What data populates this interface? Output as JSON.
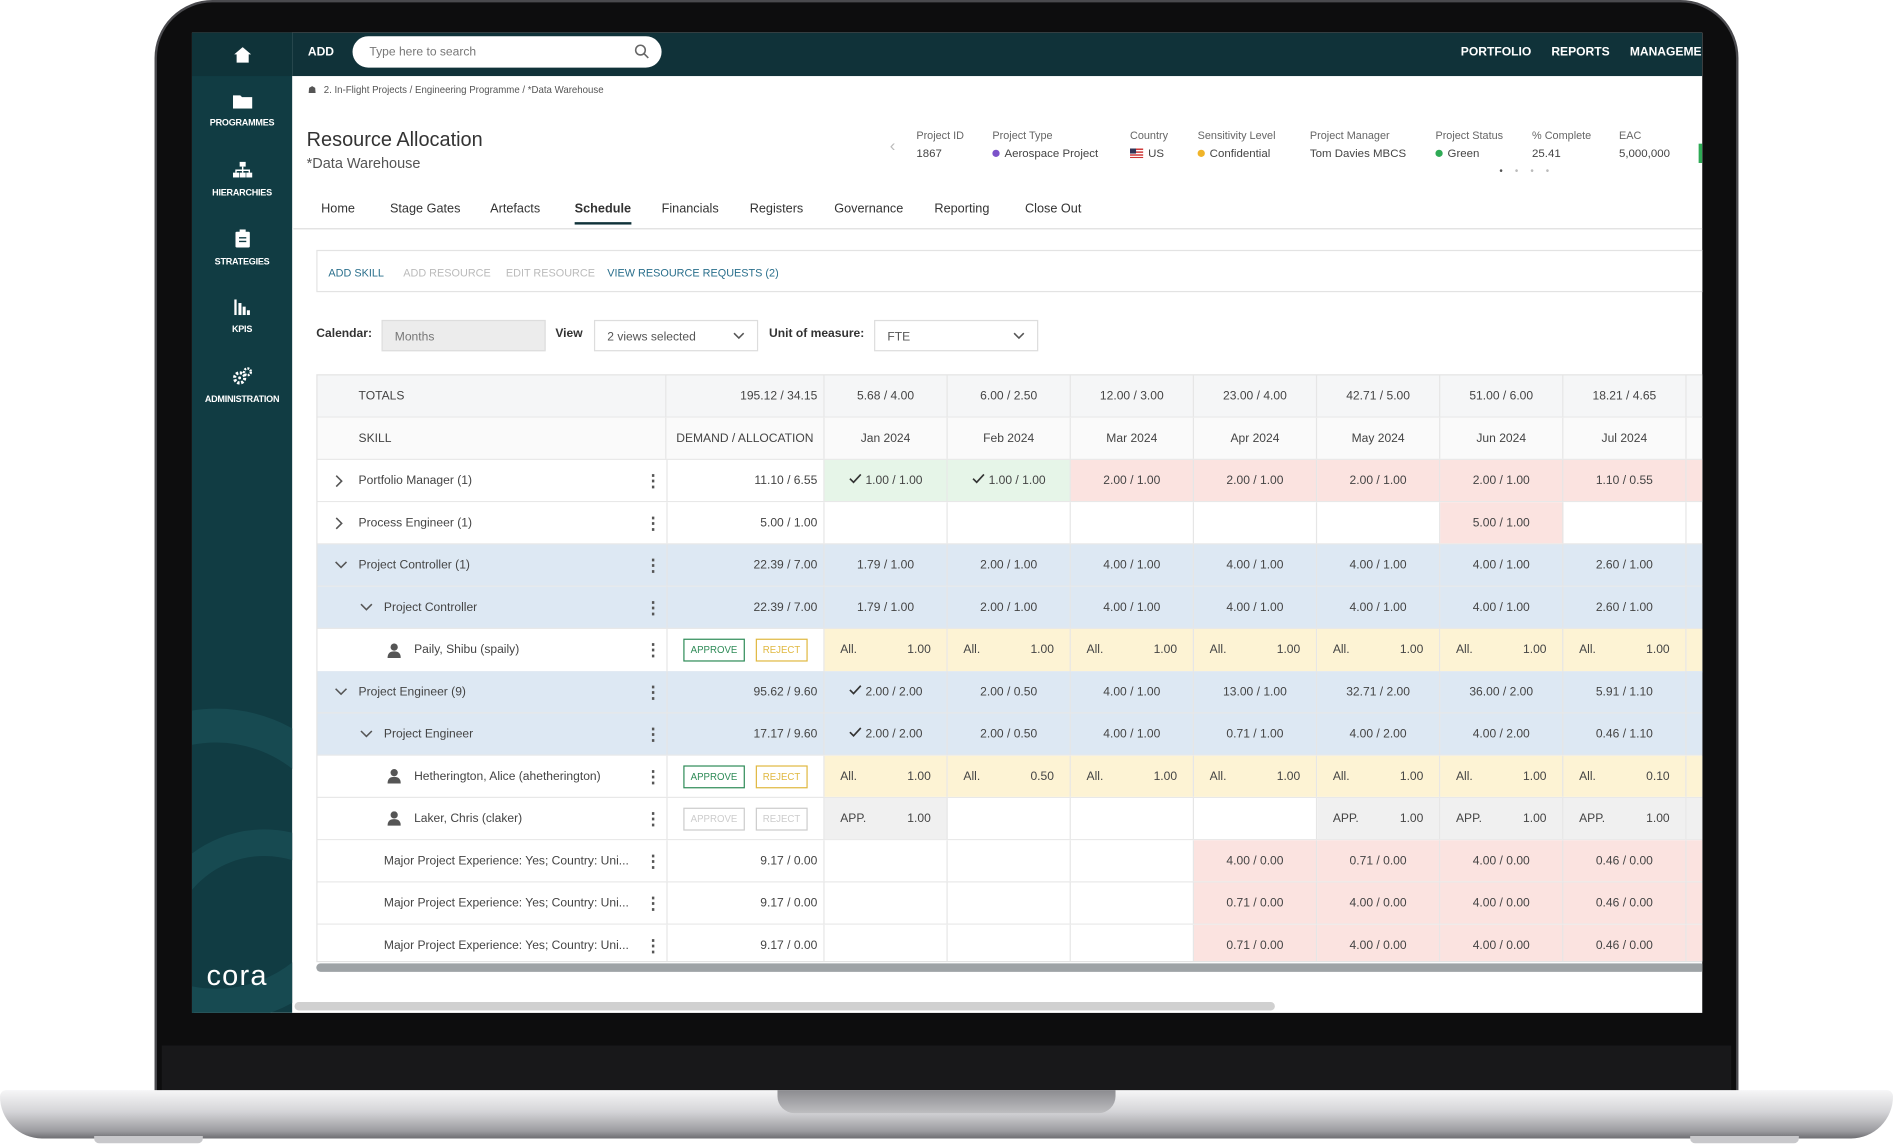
{
  "sidebar": {
    "items": [
      {
        "label": "PROGRAMMES",
        "icon": "folder-icon"
      },
      {
        "label": "HIERARCHIES",
        "icon": "hierarchy-icon"
      },
      {
        "label": "STRATEGIES",
        "icon": "clipboard-icon"
      },
      {
        "label": "KPIS",
        "icon": "bar-chart-icon"
      },
      {
        "label": "ADMINISTRATION",
        "icon": "gears-icon"
      }
    ],
    "logo": "cora"
  },
  "topbar": {
    "add_label": "ADD",
    "search_placeholder": "Type here to search",
    "menu": [
      "PORTFOLIO",
      "REPORTS",
      "MANAGEMEN"
    ]
  },
  "breadcrumb": "2. In-Flight Projects / Engineering Programme / *Data Warehouse",
  "page": {
    "title": "Resource Allocation",
    "subtitle": "*Data Warehouse"
  },
  "project_meta": [
    {
      "label": "Project ID",
      "value": "1867"
    },
    {
      "label": "Project Type",
      "value": "Aerospace Project",
      "dot": "#7b52c9"
    },
    {
      "label": "Country",
      "value": "US",
      "flag": "us-flag-icon"
    },
    {
      "label": "Sensitivity Level",
      "value": "Confidential",
      "dot": "#f0b429"
    },
    {
      "label": "Project Manager",
      "value": "Tom Davies MBCS"
    },
    {
      "label": "Project Status",
      "value": "Green",
      "dot": "#2eaa55"
    },
    {
      "label": "% Complete",
      "value": "25.41"
    },
    {
      "label": "EAC",
      "value": "5,000,000"
    }
  ],
  "tabs": [
    "Home",
    "Stage Gates",
    "Artefacts",
    "Schedule",
    "Financials",
    "Registers",
    "Governance",
    "Reporting",
    "Close Out"
  ],
  "active_tab": "Schedule",
  "actions": {
    "add_skill": "ADD SKILL",
    "add_resource": "ADD RESOURCE",
    "edit_resource": "EDIT RESOURCE",
    "view_requests": "VIEW RESOURCE REQUESTS (2)"
  },
  "filters": {
    "calendar_label": "Calendar:",
    "calendar_value": "Months",
    "view_label": "View",
    "view_value": "2 views selected",
    "unit_label": "Unit of measure:",
    "unit_value": "FTE"
  },
  "grid": {
    "totals_label": "TOTALS",
    "totals_demand": "195.12 / 34.15",
    "totals": [
      "5.68 / 4.00",
      "6.00 / 2.50",
      "12.00 / 3.00",
      "23.00 / 4.00",
      "42.71 / 5.00",
      "51.00 / 6.00",
      "18.21 / 4.65"
    ],
    "skill_header": "SKILL",
    "demand_header": "DEMAND / ALLOCATION",
    "months": [
      "Jan 2024",
      "Feb 2024",
      "Mar 2024",
      "Apr 2024",
      "May 2024",
      "Jun 2024",
      "Jul 2024"
    ],
    "approve_label": "APPROVE",
    "reject_label": "REJECT",
    "rows": [
      {
        "name": "Portfolio Manager (1)",
        "level": 0,
        "chevron": "right",
        "bg": "#ffffff",
        "demand": "11.10 / 6.55",
        "cells": [
          {
            "v": "1.00 / 1.00",
            "c": "#e6f5e8",
            "check": true
          },
          {
            "v": "1.00 / 1.00",
            "c": "#e6f5e8",
            "check": true
          },
          {
            "v": "2.00 / 1.00",
            "c": "#fbe3e0"
          },
          {
            "v": "2.00 / 1.00",
            "c": "#fbe3e0"
          },
          {
            "v": "2.00 / 1.00",
            "c": "#fbe3e0"
          },
          {
            "v": "2.00 / 1.00",
            "c": "#fbe3e0"
          },
          {
            "v": "1.10 / 0.55",
            "c": "#fbe3e0"
          }
        ]
      },
      {
        "name": "Process Engineer (1)",
        "level": 0,
        "chevron": "right",
        "bg": "#ffffff",
        "demand": "5.00 / 1.00",
        "cells": [
          {
            "v": ""
          },
          {
            "v": ""
          },
          {
            "v": ""
          },
          {
            "v": ""
          },
          {
            "v": ""
          },
          {
            "v": "5.00 / 1.00",
            "c": "#fbe3e0"
          },
          {
            "v": ""
          }
        ]
      },
      {
        "name": "Project Controller (1)",
        "level": 0,
        "chevron": "down",
        "bg": "#dde8f3",
        "demand": "22.39 / 7.00",
        "cells": [
          {
            "v": "1.79 / 1.00"
          },
          {
            "v": "2.00 / 1.00"
          },
          {
            "v": "4.00 / 1.00"
          },
          {
            "v": "4.00 / 1.00"
          },
          {
            "v": "4.00 / 1.00"
          },
          {
            "v": "4.00 / 1.00"
          },
          {
            "v": "2.60 / 1.00"
          }
        ]
      },
      {
        "name": "Project Controller",
        "level": 1,
        "chevron": "down",
        "bg": "#dde8f3",
        "demand": "22.39 / 7.00",
        "cells": [
          {
            "v": "1.79 / 1.00"
          },
          {
            "v": "2.00 / 1.00"
          },
          {
            "v": "4.00 / 1.00"
          },
          {
            "v": "4.00 / 1.00"
          },
          {
            "v": "4.00 / 1.00"
          },
          {
            "v": "4.00 / 1.00"
          },
          {
            "v": "2.60 / 1.00"
          }
        ]
      },
      {
        "name": "Paily, Shibu (spaily)",
        "level": 2,
        "person": true,
        "bg": "#ffffff",
        "buttons": "active",
        "cells": [
          {
            "l": "All.",
            "v": "1.00",
            "c": "#fdf3d4"
          },
          {
            "l": "All.",
            "v": "1.00",
            "c": "#fdf3d4"
          },
          {
            "l": "All.",
            "v": "1.00",
            "c": "#fdf3d4"
          },
          {
            "l": "All.",
            "v": "1.00",
            "c": "#fdf3d4"
          },
          {
            "l": "All.",
            "v": "1.00",
            "c": "#fdf3d4"
          },
          {
            "l": "All.",
            "v": "1.00",
            "c": "#fdf3d4"
          },
          {
            "l": "All.",
            "v": "1.00",
            "c": "#fdf3d4"
          }
        ]
      },
      {
        "name": "Project Engineer (9)",
        "level": 0,
        "chevron": "down",
        "bg": "#dde8f3",
        "demand": "95.62 / 9.60",
        "cells": [
          {
            "v": "2.00 / 2.00",
            "check": true
          },
          {
            "v": "2.00 / 0.50"
          },
          {
            "v": "4.00 / 1.00"
          },
          {
            "v": "13.00 / 1.00"
          },
          {
            "v": "32.71 / 2.00"
          },
          {
            "v": "36.00 / 2.00"
          },
          {
            "v": "5.91 / 1.10"
          }
        ]
      },
      {
        "name": "Project Engineer",
        "level": 1,
        "chevron": "down",
        "bg": "#dde8f3",
        "demand": "17.17 / 9.60",
        "cells": [
          {
            "v": "2.00 / 2.00",
            "check": true
          },
          {
            "v": "2.00 / 0.50"
          },
          {
            "v": "4.00 / 1.00"
          },
          {
            "v": "0.71 / 1.00"
          },
          {
            "v": "4.00 / 2.00"
          },
          {
            "v": "4.00 / 2.00"
          },
          {
            "v": "0.46 / 1.10"
          }
        ]
      },
      {
        "name": "Hetherington, Alice (ahetherington)",
        "level": 2,
        "person": true,
        "bg": "#ffffff",
        "buttons": "active",
        "cells": [
          {
            "l": "All.",
            "v": "1.00",
            "c": "#fdf3d4"
          },
          {
            "l": "All.",
            "v": "0.50",
            "c": "#fdf3d4"
          },
          {
            "l": "All.",
            "v": "1.00",
            "c": "#fdf3d4"
          },
          {
            "l": "All.",
            "v": "1.00",
            "c": "#fdf3d4"
          },
          {
            "l": "All.",
            "v": "1.00",
            "c": "#fdf3d4"
          },
          {
            "l": "All.",
            "v": "1.00",
            "c": "#fdf3d4"
          },
          {
            "l": "All.",
            "v": "0.10",
            "c": "#fdf3d4"
          }
        ]
      },
      {
        "name": "Laker, Chris (claker)",
        "level": 2,
        "person": true,
        "bg": "#ffffff",
        "buttons": "disabled",
        "cells": [
          {
            "l": "APP.",
            "v": "1.00",
            "c": "#f0f0f0"
          },
          {
            "v": ""
          },
          {
            "v": ""
          },
          {
            "v": ""
          },
          {
            "l": "APP.",
            "v": "1.00",
            "c": "#f0f0f0"
          },
          {
            "l": "APP.",
            "v": "1.00",
            "c": "#f0f0f0"
          },
          {
            "l": "APP.",
            "v": "1.00",
            "c": "#f0f0f0"
          }
        ]
      },
      {
        "name": "Major Project Experience: Yes; Country: Uni...",
        "level": 1,
        "bg": "#ffffff",
        "demand": "9.17 / 0.00",
        "cells": [
          {
            "v": ""
          },
          {
            "v": ""
          },
          {
            "v": ""
          },
          {
            "v": "4.00 / 0.00",
            "c": "#fbe3e0"
          },
          {
            "v": "0.71 / 0.00",
            "c": "#fbe3e0"
          },
          {
            "v": "4.00 / 0.00",
            "c": "#fbe3e0"
          },
          {
            "v": "0.46 / 0.00",
            "c": "#fbe3e0"
          }
        ]
      },
      {
        "name": "Major Project Experience: Yes; Country: Uni...",
        "level": 1,
        "bg": "#ffffff",
        "demand": "9.17 / 0.00",
        "cells": [
          {
            "v": ""
          },
          {
            "v": ""
          },
          {
            "v": ""
          },
          {
            "v": "0.71 / 0.00",
            "c": "#fbe3e0"
          },
          {
            "v": "4.00 / 0.00",
            "c": "#fbe3e0"
          },
          {
            "v": "4.00 / 0.00",
            "c": "#fbe3e0"
          },
          {
            "v": "0.46 / 0.00",
            "c": "#fbe3e0"
          }
        ]
      },
      {
        "name": "Major Project Experience: Yes; Country: Uni...",
        "level": 1,
        "bg": "#ffffff",
        "demand": "9.17 / 0.00",
        "cells": [
          {
            "v": ""
          },
          {
            "v": ""
          },
          {
            "v": ""
          },
          {
            "v": "0.71 / 0.00",
            "c": "#fbe3e0"
          },
          {
            "v": "4.00 / 0.00",
            "c": "#fbe3e0"
          },
          {
            "v": "4.00 / 0.00",
            "c": "#fbe3e0"
          },
          {
            "v": "0.46 / 0.00",
            "c": "#fbe3e0"
          }
        ]
      }
    ]
  },
  "colors": {
    "accent": "#103239",
    "link": "#2a6f8c",
    "approve": "#2e8b57",
    "reject": "#e0b840"
  }
}
